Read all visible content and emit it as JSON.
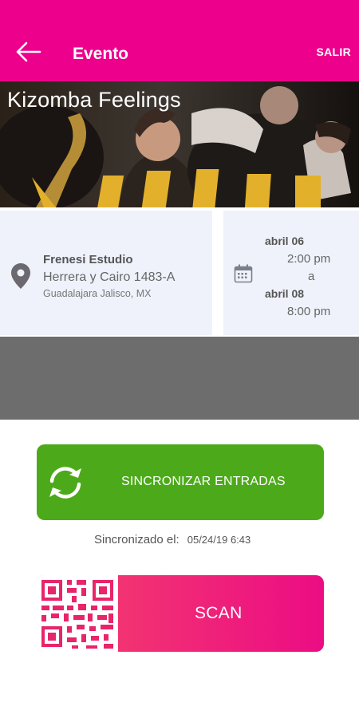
{
  "header": {
    "title": "Evento",
    "logout_label": "SALIR",
    "background_color": "#ec008c"
  },
  "banner": {
    "event_name": "Kizomba Feelings"
  },
  "venue": {
    "name": "Frenesi Estudio",
    "address": "Herrera y Cairo 1483-A",
    "city": "Guadalajara Jalisco, MX"
  },
  "schedule": {
    "start_date": "abril 06",
    "start_time": "2:00 pm",
    "separator": "a",
    "end_date": "abril 08",
    "end_time": "8:00 pm"
  },
  "sync": {
    "button_label": "SINCRONIZAR ENTRADAS",
    "status_label": "Sincronizado el:",
    "status_value": "05/24/19 6:43",
    "button_color": "#4caa1a"
  },
  "scan": {
    "button_label": "SCAN"
  },
  "icons": [
    "back-arrow-icon",
    "location-pin-icon",
    "calendar-icon",
    "refresh-icon",
    "qr-code-icon"
  ]
}
